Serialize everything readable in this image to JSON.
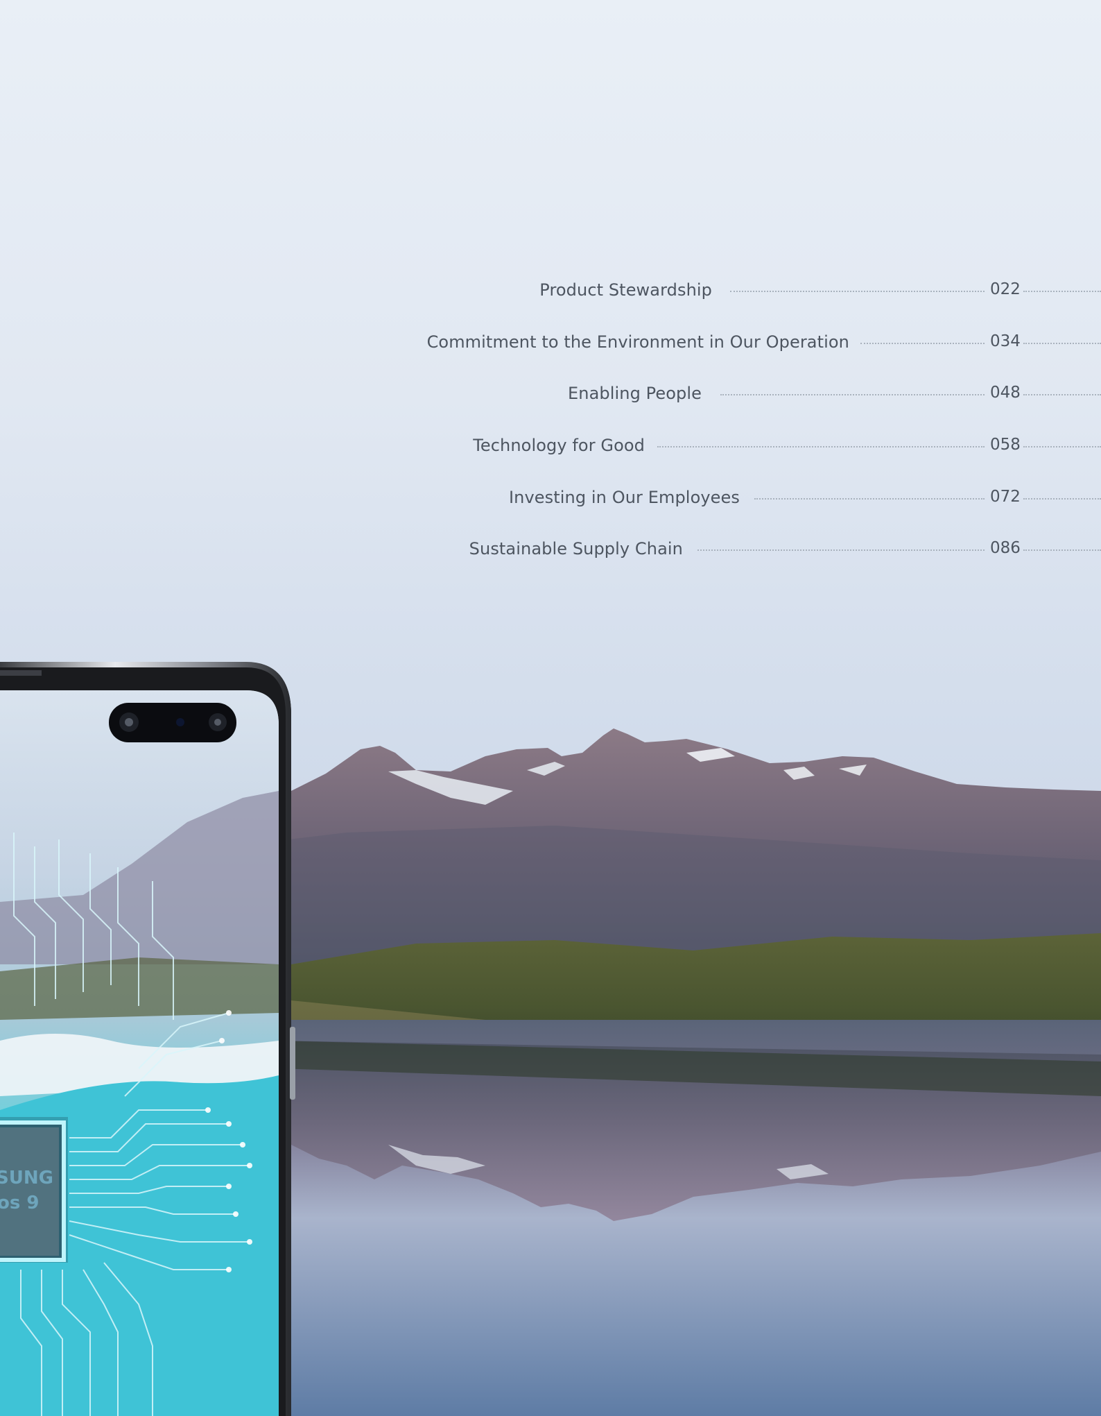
{
  "toc": {
    "items": [
      {
        "title": "Product Stewardship",
        "page": "022"
      },
      {
        "title": "Commitment to the Environment in Our Operation",
        "page": "034"
      },
      {
        "title": "Enabling People",
        "page": "048"
      },
      {
        "title": "Technology for Good",
        "page": "058"
      },
      {
        "title": "Investing in Our Employees",
        "page": "072"
      },
      {
        "title": "Sustainable Supply Chain",
        "page": "086"
      }
    ]
  },
  "phone": {
    "chip_line1": "SUNG",
    "chip_line2": "os 9"
  },
  "colors": {
    "sky_top": "#e8eef5",
    "sky_mid": "#dbe3ef",
    "mountain": "#7c6f7f",
    "grass": "#4a5a34",
    "water": "#7d93b3",
    "screen_cyan": "#3fc3d6"
  }
}
